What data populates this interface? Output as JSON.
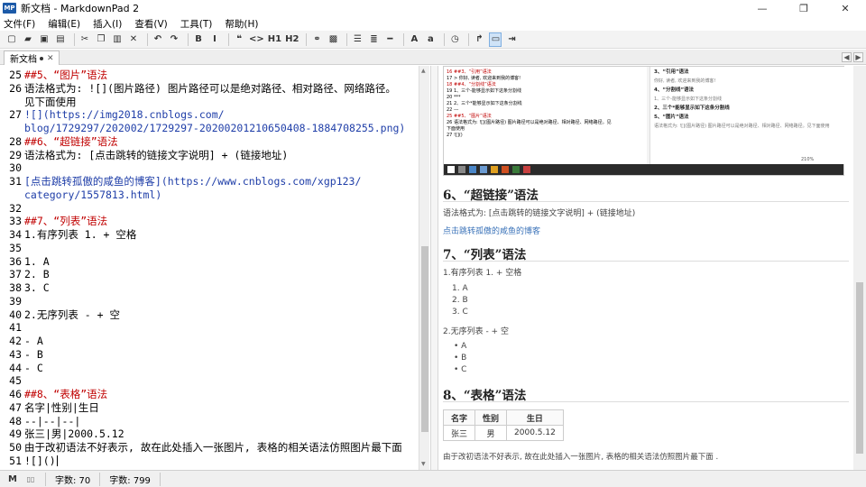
{
  "window": {
    "title": "新文档 - MarkdownPad 2",
    "app_icon_text": "MP",
    "minimize": "—",
    "restore": "❐",
    "close": "✕"
  },
  "menu": [
    "文件(F)",
    "编辑(E)",
    "插入(I)",
    "查看(V)",
    "工具(T)",
    "帮助(H)"
  ],
  "toolbar": {
    "buttons": [
      {
        "name": "new-file",
        "glyph": "▢"
      },
      {
        "name": "open-folder",
        "glyph": "▰"
      },
      {
        "name": "save",
        "glyph": "▣"
      },
      {
        "name": "save-all",
        "glyph": "▤"
      },
      {
        "name": "cut",
        "glyph": "✂"
      },
      {
        "name": "copy",
        "glyph": "❐"
      },
      {
        "name": "paste",
        "glyph": "▥"
      },
      {
        "name": "clear",
        "glyph": "✕"
      },
      {
        "name": "undo",
        "glyph": "↶"
      },
      {
        "name": "redo",
        "glyph": "↷"
      },
      {
        "name": "bold",
        "glyph": "B"
      },
      {
        "name": "italic",
        "glyph": "I"
      },
      {
        "name": "quote",
        "glyph": "❝"
      },
      {
        "name": "code",
        "glyph": "<>"
      },
      {
        "name": "h1",
        "glyph": "H1"
      },
      {
        "name": "h2",
        "glyph": "H2"
      },
      {
        "name": "link",
        "glyph": "⚭"
      },
      {
        "name": "image",
        "glyph": "▩"
      },
      {
        "name": "unordered-list",
        "glyph": "☰"
      },
      {
        "name": "ordered-list",
        "glyph": "≣"
      },
      {
        "name": "horizontal-rule",
        "glyph": "━"
      },
      {
        "name": "uppercase",
        "glyph": "A"
      },
      {
        "name": "lowercase",
        "glyph": "a"
      },
      {
        "name": "timestamp",
        "glyph": "◷"
      },
      {
        "name": "live-preview",
        "glyph": "↱"
      },
      {
        "name": "preview-window",
        "glyph": "▭"
      },
      {
        "name": "export",
        "glyph": "⇥"
      }
    ]
  },
  "tab": {
    "label": "新文档",
    "close": "✕"
  },
  "tab_nav": {
    "left": "◀",
    "right": "▶"
  },
  "editor_lines": [
    {
      "n": "25",
      "text": "##5、“图片”语法",
      "cls": "c-hd"
    },
    {
      "n": "26",
      "text": "语法格式为:  ![](图片路径) 图片路径可以是绝对路径、相对路径、网络路径。",
      "cls": ""
    },
    {
      "n": "",
      "text": "见下面使用",
      "cls": ""
    },
    {
      "n": "27",
      "text": "![](https://img2018.cnblogs.com/",
      "cls": "c-link"
    },
    {
      "n": "",
      "text": "blog/1729297/202002/1729297-20200201210650408-1884708255.png)",
      "cls": "c-link"
    },
    {
      "n": "28",
      "text": "##6、“超链接”语法",
      "cls": "c-hd"
    },
    {
      "n": "29",
      "text": "语法格式为:  [点击跳转的链接文字说明] + (链接地址)",
      "cls": ""
    },
    {
      "n": "30",
      "text": "",
      "cls": ""
    },
    {
      "n": "31",
      "text": "[点击跳转孤傲的咸鱼的博客](https://www.cnblogs.com/xgp123/",
      "cls": "c-link"
    },
    {
      "n": "",
      "text": "category/1557813.html)",
      "cls": "c-link"
    },
    {
      "n": "32",
      "text": "",
      "cls": ""
    },
    {
      "n": "33",
      "text": "##7、“列表”语法",
      "cls": "c-hd"
    },
    {
      "n": "34",
      "text": "1.有序列表 1. + 空格",
      "cls": ""
    },
    {
      "n": "35",
      "text": "",
      "cls": ""
    },
    {
      "n": "36",
      "text": "1. A",
      "cls": ""
    },
    {
      "n": "37",
      "text": "2. B",
      "cls": ""
    },
    {
      "n": "38",
      "text": "3. C",
      "cls": ""
    },
    {
      "n": "39",
      "text": "",
      "cls": ""
    },
    {
      "n": "40",
      "text": "2.无序列表 - + 空",
      "cls": ""
    },
    {
      "n": "41",
      "text": "",
      "cls": ""
    },
    {
      "n": "42",
      "text": "- A",
      "cls": ""
    },
    {
      "n": "43",
      "text": "- B",
      "cls": ""
    },
    {
      "n": "44",
      "text": "- C",
      "cls": ""
    },
    {
      "n": "45",
      "text": "",
      "cls": ""
    },
    {
      "n": "46",
      "text": "##8、“表格”语法",
      "cls": "c-hd"
    },
    {
      "n": "47",
      "text": "名字|性别|生日",
      "cls": ""
    },
    {
      "n": "48",
      "text": "--|--|--|",
      "cls": ""
    },
    {
      "n": "49",
      "text": "张三|男|2000.5.12",
      "cls": ""
    },
    {
      "n": "50",
      "text": "由于改初语法不好表示, 故在此处插入一张图片, 表格的相关语法仿照图片最下面",
      "cls": ""
    },
    {
      "n": "51",
      "text": "![]()",
      "cls": ""
    }
  ],
  "preview": {
    "shot_left": [
      {
        "text": "16 ##3、“引用”语法",
        "hd": true
      },
      {
        "text": "17 > 你好, 读者, 欢迎来到我的博客!",
        "hd": false
      },
      {
        "text": "18 ##4、“分割线”语法",
        "hd": true
      },
      {
        "text": "19 1、三个-能够显示如下这条分割线",
        "hd": false
      },
      {
        "text": "20 ***",
        "hd": false
      },
      {
        "text": "21 2、三个*能够显示如下这条分割线",
        "hd": false
      },
      {
        "text": "22 ---",
        "hd": false
      },
      {
        "text": "25 ##5、“图片”语法",
        "hd": true
      },
      {
        "text": "26 语法格式为: ![](图片路径) 图片路径可以是绝对路径、相对路径、网络路径。见",
        "hd": false
      },
      {
        "text": "   下面使用",
        "hd": false
      },
      {
        "text": "27 ![]()",
        "hd": false
      }
    ],
    "shot_right": [
      {
        "text": "3、“引用”语法",
        "bold": true
      },
      {
        "text": "你好, 读者, 欢迎来到我的博客!",
        "bold": false
      },
      {
        "text": "4、“分割线”语法",
        "bold": true
      },
      {
        "text": "1、三个-能够显示如下这条分割线",
        "bold": false
      },
      {
        "text": "2、三个*能够显示如下这条分割线",
        "bold": true
      },
      {
        "text": "5、“图片”语法",
        "bold": true
      },
      {
        "text": "语法格式为: ![](图片路径) 图片路径可以是绝对路径、相对路径、网络路径。见下面使用",
        "bold": false
      }
    ],
    "shot_zoom": "210%",
    "h6": "6、“超链接”语法",
    "p_link_syntax": "语法格式为:  [点击跳转的链接文字说明] + (链接地址)",
    "link_text": "点击跳转孤傲的咸鱼的博客",
    "h7": "7、“列表”语法",
    "p_ordered": "1.有序列表 1. + 空格",
    "ordered": [
      "A",
      "B",
      "C"
    ],
    "p_unordered": "2.无序列表 - + 空",
    "unordered": [
      "A",
      "B",
      "C"
    ],
    "h8": "8、“表格”语法",
    "table": {
      "headers": [
        "名字",
        "性别",
        "生日"
      ],
      "row": [
        "张三",
        "男",
        "2000.5.12"
      ]
    },
    "p_footer": "由于改初语法不好表示, 故在此处插入一张图片, 表格的相关语法仿照图片最下面 ."
  },
  "status": {
    "words_label": "字数: 70",
    "chars_label": "字数: 799",
    "markdown_icon": "M",
    "book_icon": "▯▯"
  }
}
